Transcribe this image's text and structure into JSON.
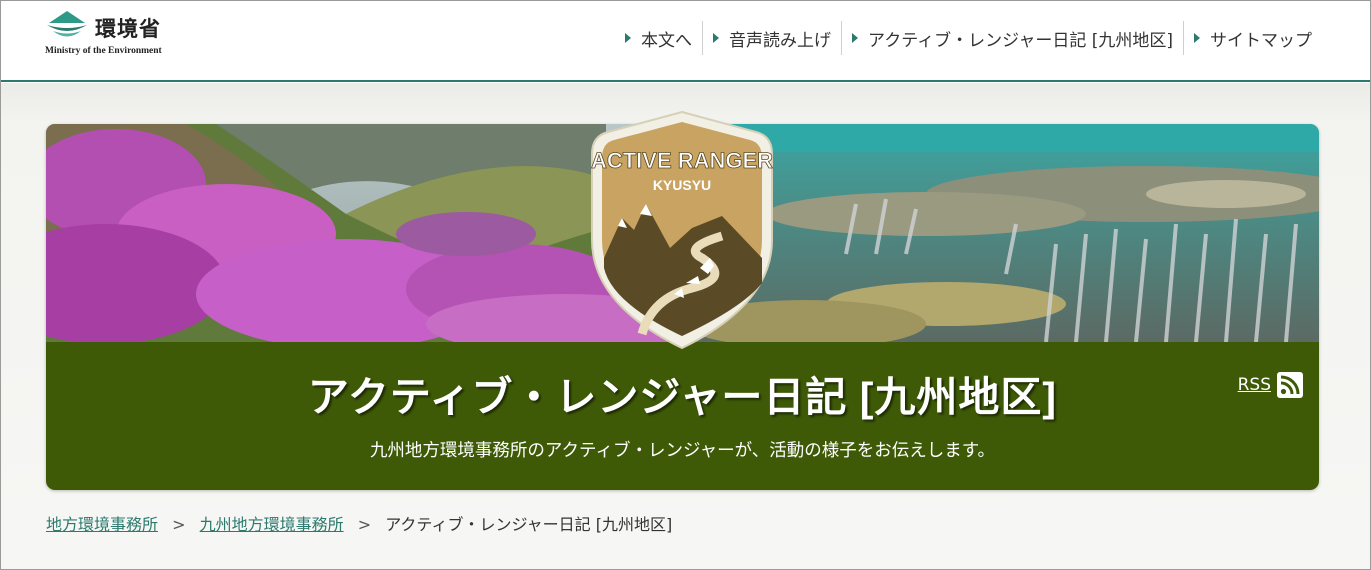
{
  "header": {
    "logo_kanji": "環境省",
    "logo_english": "Ministry of the Environment",
    "nav": [
      {
        "label": "本文へ"
      },
      {
        "label": "音声読み上げ"
      },
      {
        "label": "アクティブ・レンジャー日記 [九州地区]"
      },
      {
        "label": "サイトマップ"
      }
    ]
  },
  "banner": {
    "badge_line1": "ACTIVE RANGER",
    "badge_line2": "KYUSYU",
    "title": "アクティブ・レンジャー日記 [九州地区]",
    "subtitle": "九州地方環境事務所のアクティブ・レンジャーが、活動の様子をお伝えします。",
    "rss_label": "RSS"
  },
  "breadcrumb": {
    "items": [
      {
        "label": "地方環境事務所"
      },
      {
        "label": "九州地方環境事務所"
      }
    ],
    "separator": ">",
    "current": "アクティブ・レンジャー日記 [九州地区]"
  },
  "colors": {
    "accent": "#2c7a6e",
    "banner_green": "#3e5a07",
    "badge_gold": "#c9a361",
    "badge_brown": "#5a4a26"
  }
}
